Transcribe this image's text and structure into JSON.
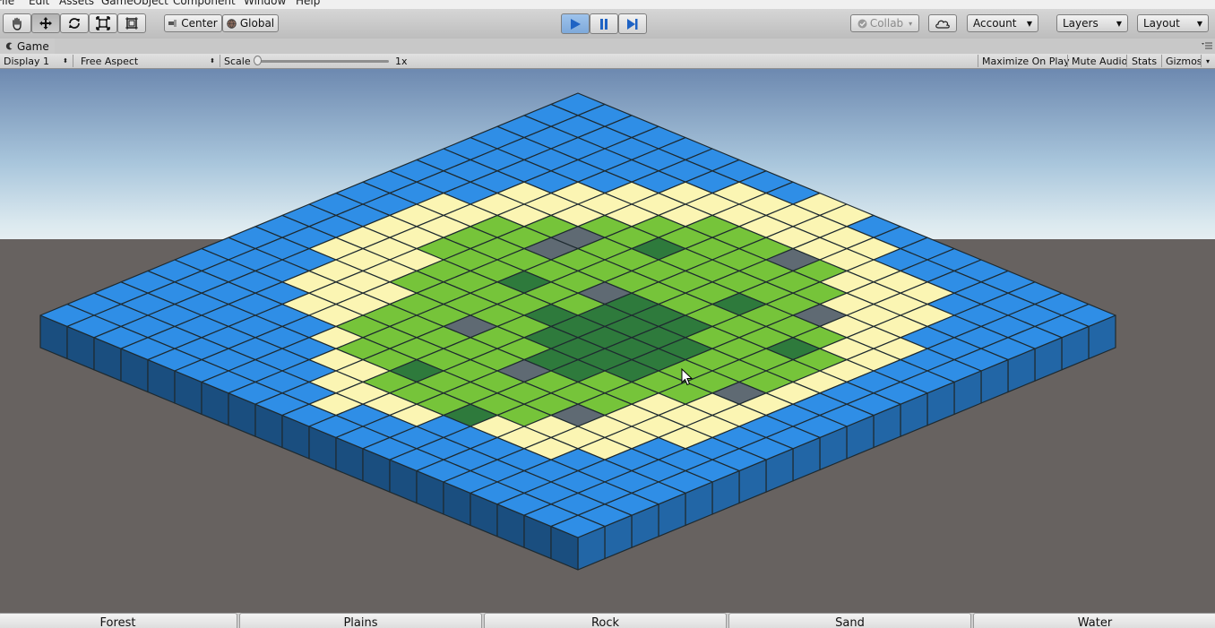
{
  "menu": [
    "File",
    "Edit",
    "Assets",
    "GameObject",
    "Component",
    "Window",
    "Help"
  ],
  "toolbar": {
    "tools": [
      {
        "name": "hand-tool-icon",
        "active": false
      },
      {
        "name": "move-tool-icon",
        "active": true
      },
      {
        "name": "rotate-tool-icon",
        "active": false
      },
      {
        "name": "scale-tool-icon",
        "active": false
      },
      {
        "name": "rect-tool-icon",
        "active": false
      }
    ],
    "pivot_label": "Center",
    "space_label": "Global",
    "collab_label": "Collab",
    "account_label": "Account",
    "layers_label": "Layers",
    "layout_label": "Layout",
    "play_active": true
  },
  "game_tab": {
    "title": "Game",
    "display": "Display 1",
    "aspect": "Free Aspect",
    "scale_label": "Scale",
    "scale_value": "1x",
    "maximize_on_play": "Maximize On Play",
    "mute_audio": "Mute Audio",
    "stats": "Stats",
    "gizmos": "Gizmos"
  },
  "colors": {
    "water": "#2f8ee6",
    "sand": "#fbf5b3",
    "plains": "#76c43a",
    "forest": "#2e7a3c",
    "rock": "#5f6a73",
    "grid_line": "#1e2a30",
    "accent_play": "#1f63c4"
  },
  "tile_buttons": [
    "Forest",
    "Plains",
    "Rock",
    "Sand",
    "Water"
  ]
}
